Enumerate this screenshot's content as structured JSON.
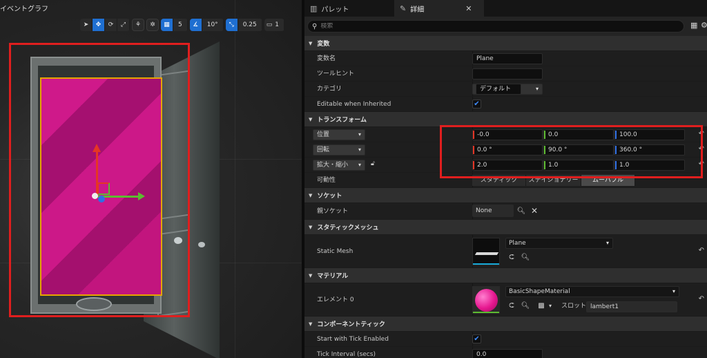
{
  "viewport": {
    "title": "イベントグラフ",
    "toolbar": {
      "snap_grid": "5",
      "snap_angle": "10°",
      "snap_scale": "0.25",
      "camera_speed": "1"
    }
  },
  "tabs": [
    {
      "label": "パレット",
      "icon": "palette-icon"
    },
    {
      "label": "詳細",
      "icon": "pencil-icon"
    }
  ],
  "search": {
    "placeholder": "検索"
  },
  "sections": {
    "variable": {
      "title": "変数",
      "name_label": "変数名",
      "name_value": "Plane",
      "tooltip_label": "ツールヒント",
      "tooltip_value": "",
      "category_label": "カテゴリ",
      "category_value": "デフォルト",
      "editable_label": "Editable when Inherited",
      "editable_checked": true
    },
    "transform": {
      "title": "トランスフォーム",
      "location_label": "位置",
      "location": [
        "-0.0",
        "0.0",
        "100.0"
      ],
      "rotation_label": "回転",
      "rotation": [
        "0.0 °",
        "90.0 °",
        "360.0 °"
      ],
      "scale_label": "拡大・縮小",
      "scale": [
        "2.0",
        "1.0",
        "1.0"
      ],
      "mobility_label": "可動性",
      "mobility_options": [
        "スタティック",
        "ステイショナリー",
        "ムーバブル"
      ],
      "mobility_selected": "ムーバブル"
    },
    "socket": {
      "title": "ソケット",
      "parent_label": "親ソケット",
      "parent_value": "None"
    },
    "static_mesh": {
      "title": "スタティックメッシュ",
      "label": "Static Mesh",
      "value": "Plane"
    },
    "material": {
      "title": "マテリアル",
      "element_label": "エレメント 0",
      "value": "BasicShapeMaterial",
      "slot_label": "スロット",
      "slot_value": "lambert1"
    },
    "component_tick": {
      "title": "コンポーネントティック",
      "start_label": "Start with Tick Enabled",
      "start_checked": true,
      "interval_label": "Tick Interval (secs)",
      "interval_value": "0.0"
    }
  },
  "colors": {
    "accent": "#1f6fd1",
    "highlight": "#e01e1e",
    "axis_x": "#e53525",
    "axis_y": "#5dbb31",
    "axis_z": "#2e6fe4",
    "material": "#e6178f"
  }
}
